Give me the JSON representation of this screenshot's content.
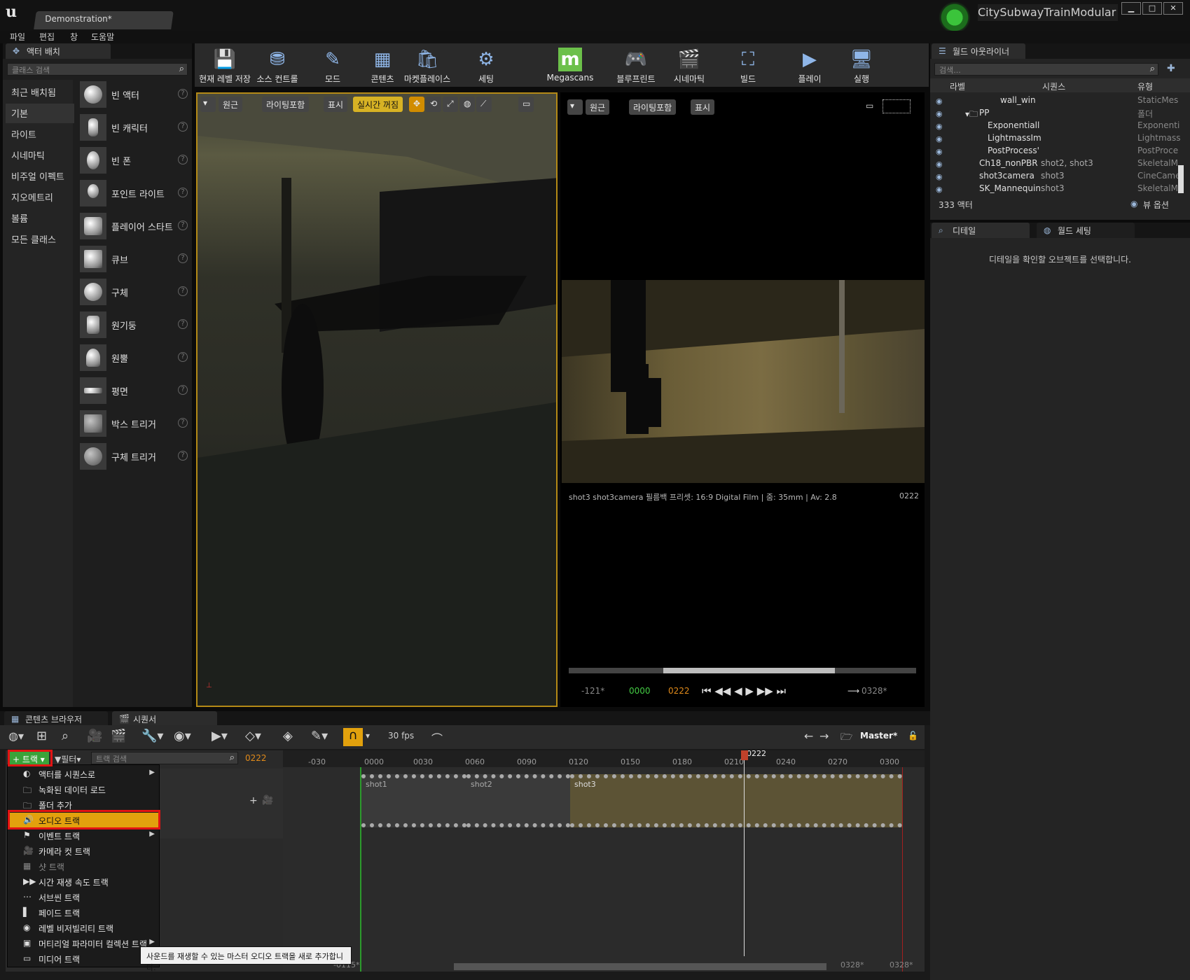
{
  "window": {
    "doc_tab": "Demonstration*",
    "project": "CitySubwayTrainModular",
    "controls": {
      "min": "▁",
      "max": "□",
      "close": "✕"
    }
  },
  "menu": [
    "파일",
    "편집",
    "창",
    "도움말"
  ],
  "place_actors": {
    "tab": "액터 배치",
    "search_placeholder": "클래스 검색",
    "categories": [
      "최근 배치됨",
      "기본",
      "라이트",
      "시네마틱",
      "비주얼 이펙트",
      "지오메트리",
      "볼륨",
      "모든 클래스"
    ],
    "selected_category": "기본",
    "items": [
      "빈 액터",
      "빈 캐릭터",
      "빈 폰",
      "포인트 라이트",
      "플레이어 스타트",
      "큐브",
      "구체",
      "원기둥",
      "원뿔",
      "평면",
      "박스 트리거",
      "구체 트리거"
    ]
  },
  "toolbar": [
    "현재 레벨 저장",
    "소스 컨트롤",
    "모드",
    "콘텐츠",
    "마켓플레이스",
    "세팅",
    "Megascans",
    "블루프린트",
    "시네마틱",
    "빌드",
    "플레이",
    "실행"
  ],
  "viewport_left": {
    "buttons": [
      "원근",
      "라이팅포함",
      "표시",
      "실시간 꺼짐"
    ]
  },
  "viewport_right": {
    "buttons": [
      "원근",
      "라이팅포함",
      "표시"
    ],
    "camera_info": "shot3  shot3camera   필름백 프리셋: 16:9 Digital Film | 줌: 35mm | Av: 2.8",
    "frame": "0222",
    "playback": {
      "start": "-121*",
      "in": "0000",
      "current": "0222",
      "end": "0328*"
    }
  },
  "bottom_tabs": [
    "콘텐츠 브라우저",
    "시퀀서"
  ],
  "sequencer": {
    "fps": "30 fps",
    "sequence_name": "Master*",
    "track_button": "트랙",
    "filter": "필터",
    "track_search_placeholder": "트랙 검색",
    "current_frame": "0222",
    "ruler_ticks": [
      "-030",
      "0000",
      "0030",
      "0060",
      "0090",
      "0120",
      "0150",
      "0180",
      "0210",
      "0240",
      "0270",
      "0300"
    ],
    "playhead": "0222",
    "shots": [
      "shot1",
      "shot2",
      "shot3"
    ],
    "bottom_left": "-0115*",
    "bottom_right1": "0328*",
    "bottom_right2": "0328*"
  },
  "track_menu": {
    "items": [
      "액터를 시퀀스로",
      "녹화된 데이터 로드",
      "폴더 추가",
      "오디오 트랙",
      "이벤트 트랙",
      "카메라 컷 트랙",
      "샷 트랙",
      "시간 재생 속도 트랙",
      "서브씬 트랙",
      "페이드 트랙",
      "레벨 비저빌리티 트랙",
      "머티리얼 파라미터 컬렉션 트랙",
      "미디어 트랙"
    ],
    "highlighted": "오디오 트랙",
    "tooltip": "사운드를 재생할 수 있는 마스터 오디오 트랙을 새로 추가합니다."
  },
  "outliner": {
    "tab": "월드 아웃라이너",
    "search_placeholder": "검색...",
    "columns": [
      "라벨",
      "시퀀스",
      "유형"
    ],
    "rows": [
      {
        "label": "wall_win",
        "sequence": "",
        "type": "StaticMes"
      },
      {
        "label": "PP",
        "sequence": "",
        "type": "폴더"
      },
      {
        "label": "Exponentiall",
        "sequence": "",
        "type": "Exponenti"
      },
      {
        "label": "LightmassIm",
        "sequence": "",
        "type": "Lightmass"
      },
      {
        "label": "PostProcess'",
        "sequence": "",
        "type": "PostProce"
      },
      {
        "label": "Ch18_nonPBR",
        "sequence": "shot2, shot3",
        "type": "SkeletalM"
      },
      {
        "label": "shot3camera",
        "sequence": "shot3",
        "type": "CineCame"
      },
      {
        "label": "SK_Mannequin",
        "sequence": "shot3",
        "type": "SkeletalM"
      }
    ],
    "count": "333 액터",
    "view_options": "뷰 옵션"
  },
  "details": {
    "tabs": [
      "디테일",
      "월드 세팅"
    ],
    "empty_message": "디테일을 확인할 오브젝트를 선택합니다."
  },
  "colors": {
    "accent": "#e2a10d",
    "highlight_box": "#e21313",
    "add_button": "#3aa33a"
  }
}
